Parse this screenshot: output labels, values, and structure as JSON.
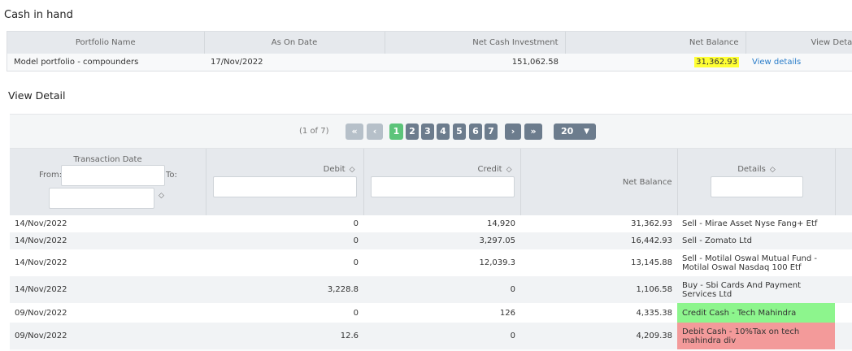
{
  "header": {
    "title": "Cash in hand"
  },
  "summary": {
    "columns": [
      "Portfolio Name",
      "As On Date",
      "Net Cash Investment",
      "Net Balance",
      "View Details"
    ],
    "row": {
      "portfolio_name": "Model portfolio - compounders",
      "as_on_date": "17/Nov/2022",
      "net_cash_investment": "151,062.58",
      "net_balance": "31,362.93",
      "view_link": "View details"
    },
    "highlight_color": "#ffff33"
  },
  "detail": {
    "title": "View Detail",
    "pager": {
      "count": "(1 of 7)",
      "first": "«",
      "prev": "‹",
      "pages": [
        "1",
        "2",
        "3",
        "4",
        "5",
        "6",
        "7"
      ],
      "current": "1",
      "next": "›",
      "last": "»",
      "rows_per_page": "20"
    },
    "columns": {
      "date": "Transaction Date",
      "from": "From:",
      "to": "To:",
      "debit": "Debit",
      "credit": "Credit",
      "net_balance": "Net Balance",
      "details": "Details"
    },
    "rows": [
      {
        "date": "14/Nov/2022",
        "debit": "0",
        "credit": "14,920",
        "net": "31,362.93",
        "details": "Sell - Mirae Asset Nyse Fang+ Etf"
      },
      {
        "date": "14/Nov/2022",
        "debit": "0",
        "credit": "3,297.05",
        "net": "16,442.93",
        "details": "Sell - Zomato Ltd"
      },
      {
        "date": "14/Nov/2022",
        "debit": "0",
        "credit": "12,039.3",
        "net": "13,145.88",
        "details": "Sell - Motilal Oswal Mutual Fund - Motilal Oswal Nasdaq 100 Etf"
      },
      {
        "date": "14/Nov/2022",
        "debit": "3,228.8",
        "credit": "0",
        "net": "1,106.58",
        "details": "Buy - Sbi Cards And Payment Services Ltd"
      },
      {
        "date": "09/Nov/2022",
        "debit": "0",
        "credit": "126",
        "net": "4,335.38",
        "details": "Credit Cash - Tech Mahindra"
      },
      {
        "date": "09/Nov/2022",
        "debit": "12.6",
        "credit": "0",
        "net": "4,209.38",
        "details": "Debit Cash - 10%Tax on tech mahindra div"
      }
    ],
    "colors": {
      "credit_row": "#8df58d",
      "debit_row": "#f39a9a",
      "pager_active": "#5cc47a",
      "pager_button": "#6c7c8d"
    }
  }
}
